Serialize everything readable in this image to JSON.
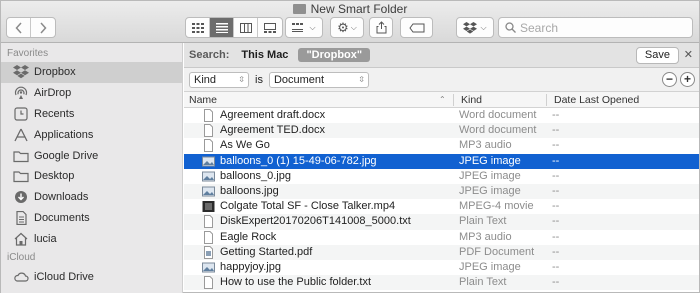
{
  "window": {
    "title": "New Smart Folder"
  },
  "toolbar": {
    "back_icon": "chevron-left-icon",
    "forward_icon": "chevron-right-icon",
    "view_modes": [
      "icon-view",
      "list-view",
      "column-view",
      "gallery-view"
    ],
    "active_view": "list-view",
    "search_placeholder": "Search"
  },
  "sidebar": {
    "favorites_label": "Favorites",
    "items": [
      {
        "label": "Dropbox",
        "icon": "dropbox-icon",
        "selected": true
      },
      {
        "label": "AirDrop",
        "icon": "airdrop-icon"
      },
      {
        "label": "Recents",
        "icon": "clock-icon"
      },
      {
        "label": "Applications",
        "icon": "applications-icon"
      },
      {
        "label": "Google Drive",
        "icon": "folder-icon"
      },
      {
        "label": "Desktop",
        "icon": "desktop-icon"
      },
      {
        "label": "Downloads",
        "icon": "download-icon"
      },
      {
        "label": "Documents",
        "icon": "document-icon"
      },
      {
        "label": "lucia",
        "icon": "home-icon"
      }
    ],
    "icloud_label": "iCloud",
    "icloud_items": [
      {
        "label": "iCloud Drive",
        "icon": "cloud-icon"
      }
    ]
  },
  "search_bar": {
    "label": "Search:",
    "scope_this_mac": "This Mac",
    "scope_selected": "\"Dropbox\"",
    "save_label": "Save"
  },
  "criteria": {
    "attribute": "Kind",
    "operator": "is",
    "value": "Document"
  },
  "columns": {
    "name": "Name",
    "kind": "Kind",
    "date": "Date Last Opened"
  },
  "files": [
    {
      "name": "Agreement draft.docx",
      "kind": "Word document",
      "date": "--",
      "icon": "doc"
    },
    {
      "name": "Agreement TED.docx",
      "kind": "Word document",
      "date": "--",
      "icon": "doc"
    },
    {
      "name": "As We Go",
      "kind": "MP3 audio",
      "date": "--",
      "icon": "doc"
    },
    {
      "name": "balloons_0 (1) 15-49-06-782.jpg",
      "kind": "JPEG image",
      "date": "--",
      "icon": "img",
      "selected": true
    },
    {
      "name": "balloons_0.jpg",
      "kind": "JPEG image",
      "date": "--",
      "icon": "img"
    },
    {
      "name": "balloons.jpg",
      "kind": "JPEG image",
      "date": "--",
      "icon": "img"
    },
    {
      "name": "Colgate Total SF - Close Talker.mp4",
      "kind": "MPEG-4 movie",
      "date": "--",
      "icon": "video"
    },
    {
      "name": "DiskExpert20170206T141008_5000.txt",
      "kind": "Plain Text",
      "date": "--",
      "icon": "doc"
    },
    {
      "name": "Eagle Rock",
      "kind": "MP3 audio",
      "date": "--",
      "icon": "doc"
    },
    {
      "name": "Getting Started.pdf",
      "kind": "PDF Document",
      "date": "--",
      "icon": "pdf"
    },
    {
      "name": "happyjoy.jpg",
      "kind": "JPEG image",
      "date": "--",
      "icon": "img"
    },
    {
      "name": "How to use the Public folder.txt",
      "kind": "Plain Text",
      "date": "--",
      "icon": "doc"
    }
  ],
  "colors": {
    "selection": "#1161d1",
    "sidebar_bg": "#e9e8e9"
  }
}
